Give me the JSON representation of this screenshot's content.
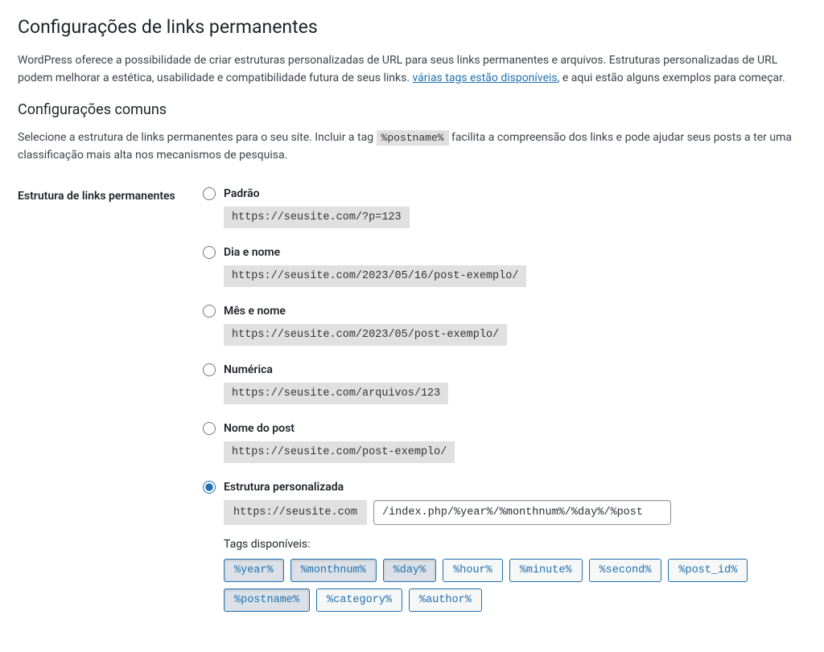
{
  "page_title": "Configurações de links permanentes",
  "intro_p1": "WordPress oferece a possibilidade de criar estruturas personalizadas de URL para seus links permanentes e arquivos. Estruturas personalizadas de URL podem melhorar a estética, usabilidade e compatibilidade futura de seus links. ",
  "intro_link": "várias tags estão disponíveis",
  "intro_p2": ", e aqui estão alguns exemplos para começar.",
  "common_heading": "Configurações comuns",
  "common_p_before": "Selecione a estrutura de links permanentes para o seu site. Incluir a tag ",
  "common_code": "%postname%",
  "common_p_after": " facilita a compreensão dos links e pode ajudar seus posts a ter uma classificação mais alta nos mecanismos de pesquisa.",
  "section_label": "Estrutura de links permanentes",
  "options": [
    {
      "label": "Padrão",
      "example": "https://seusite.com/?p=123",
      "checked": false
    },
    {
      "label": "Dia e nome",
      "example": "https://seusite.com/2023/05/16/post-exemplo/",
      "checked": false
    },
    {
      "label": "Mês e nome",
      "example": "https://seusite.com/2023/05/post-exemplo/",
      "checked": false
    },
    {
      "label": "Numérica",
      "example": "https://seusite.com/arquivos/123",
      "checked": false
    },
    {
      "label": "Nome do post",
      "example": "https://seusite.com/post-exemplo/",
      "checked": false
    }
  ],
  "custom": {
    "label": "Estrutura personalizada",
    "checked": true,
    "prefix": "https://seusite.com",
    "value": "/index.php/%year%/%monthnum%/%day%/%post"
  },
  "tags_label": "Tags disponíveis:",
  "tags": [
    {
      "text": "%year%",
      "active": true
    },
    {
      "text": "%monthnum%",
      "active": true
    },
    {
      "text": "%day%",
      "active": true
    },
    {
      "text": "%hour%",
      "active": false
    },
    {
      "text": "%minute%",
      "active": false
    },
    {
      "text": "%second%",
      "active": false
    },
    {
      "text": "%post_id%",
      "active": false
    },
    {
      "text": "%postname%",
      "active": true
    },
    {
      "text": "%category%",
      "active": false
    },
    {
      "text": "%author%",
      "active": false
    }
  ]
}
